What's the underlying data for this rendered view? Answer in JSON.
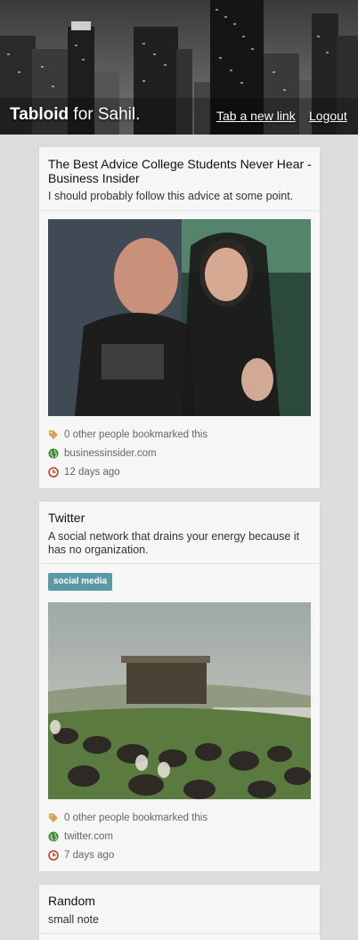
{
  "header": {
    "brand_name": "Tabloid",
    "brand_suffix": " for Sahil.",
    "tab_link": "Tab a new link",
    "logout": "Logout"
  },
  "posts": [
    {
      "title": "The Best Advice College Students Never Hear - Business Insider",
      "description": "I should probably follow this advice at some point.",
      "bookmarks": "0 other people bookmarked this",
      "domain": "businessinsider.com",
      "age": "12 days ago"
    },
    {
      "title": "Twitter",
      "description": "A social network that drains your energy because it has no organization.",
      "tag": "social media",
      "bookmarks": "0 other people bookmarked this",
      "domain": "twitter.com",
      "age": "7 days ago"
    },
    {
      "title": "Random",
      "description": "small note"
    }
  ],
  "colors": {
    "tag_bg": "#5a9aa6",
    "bookmark_icon": "#d1a551",
    "globe_icon": "#3f8a3a",
    "clock_icon": "#c0392b"
  }
}
